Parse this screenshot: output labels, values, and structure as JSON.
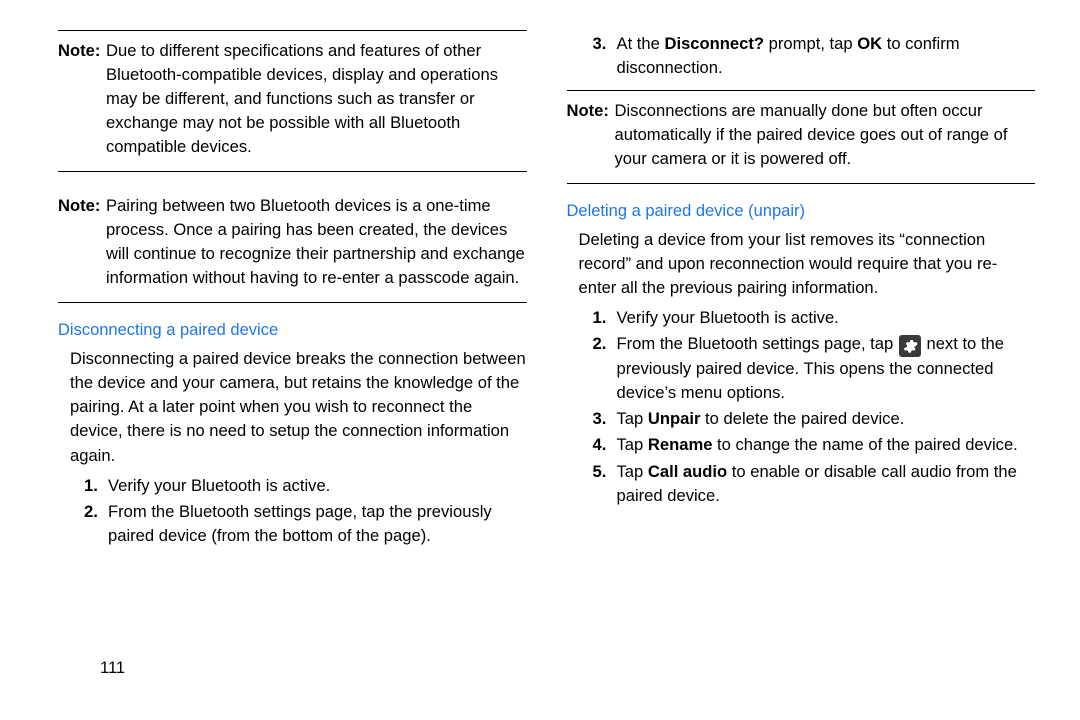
{
  "page_number": "111",
  "left": {
    "notes": [
      {
        "label": "Note:",
        "text": "Due to different specifications and features of other Bluetooth-compatible devices, display and operations may be different, and functions such as transfer or exchange may not be possible with all Bluetooth compatible devices."
      },
      {
        "label": "Note:",
        "text": "Pairing between two Bluetooth devices is a one-time process. Once a pairing has been created, the devices will continue to recognize their partnership and exchange information without having to re-enter a passcode again."
      }
    ],
    "section": {
      "heading": "Disconnecting a paired device",
      "intro": "Disconnecting a paired device breaks the connection between the device and your camera, but retains the knowledge of the pairing. At a later point when you wish to reconnect the device, there is no need to setup the connection information again.",
      "steps": [
        {
          "n": "1.",
          "t": "Verify your Bluetooth is active."
        },
        {
          "n": "2.",
          "t": "From the Bluetooth settings page, tap the previously paired device (from the bottom of the page)."
        }
      ]
    }
  },
  "right": {
    "cont_step": {
      "n": "3.",
      "t1": "At the ",
      "b1": "Disconnect?",
      "t2": " prompt, tap ",
      "b2": "OK",
      "t3": " to confirm disconnection."
    },
    "note": {
      "label": "Note:",
      "text": "Disconnections are manually done but often occur automatically if the paired device goes out of range of your camera or it is powered off."
    },
    "section": {
      "heading": "Deleting a paired device (unpair)",
      "intro": "Deleting a device from your list removes its “connection record” and upon reconnection would require that you re-enter all the previous pairing information.",
      "steps": [
        {
          "n": "1.",
          "t": "Verify your Bluetooth is active."
        },
        {
          "n": "2.",
          "t_pre": "From the Bluetooth settings page, tap ",
          "icon": "gear-icon",
          "t_post": " next to the previously paired device. This opens the connected device’s menu options."
        },
        {
          "n": "3.",
          "t1": "Tap ",
          "b": "Unpair",
          "t2": " to delete the paired device."
        },
        {
          "n": "4.",
          "t1": "Tap ",
          "b": "Rename",
          "t2": " to change the name of the paired device."
        },
        {
          "n": "5.",
          "t1": "Tap ",
          "b": "Call audio",
          "t2": " to enable or disable call audio from the paired device."
        }
      ]
    }
  }
}
